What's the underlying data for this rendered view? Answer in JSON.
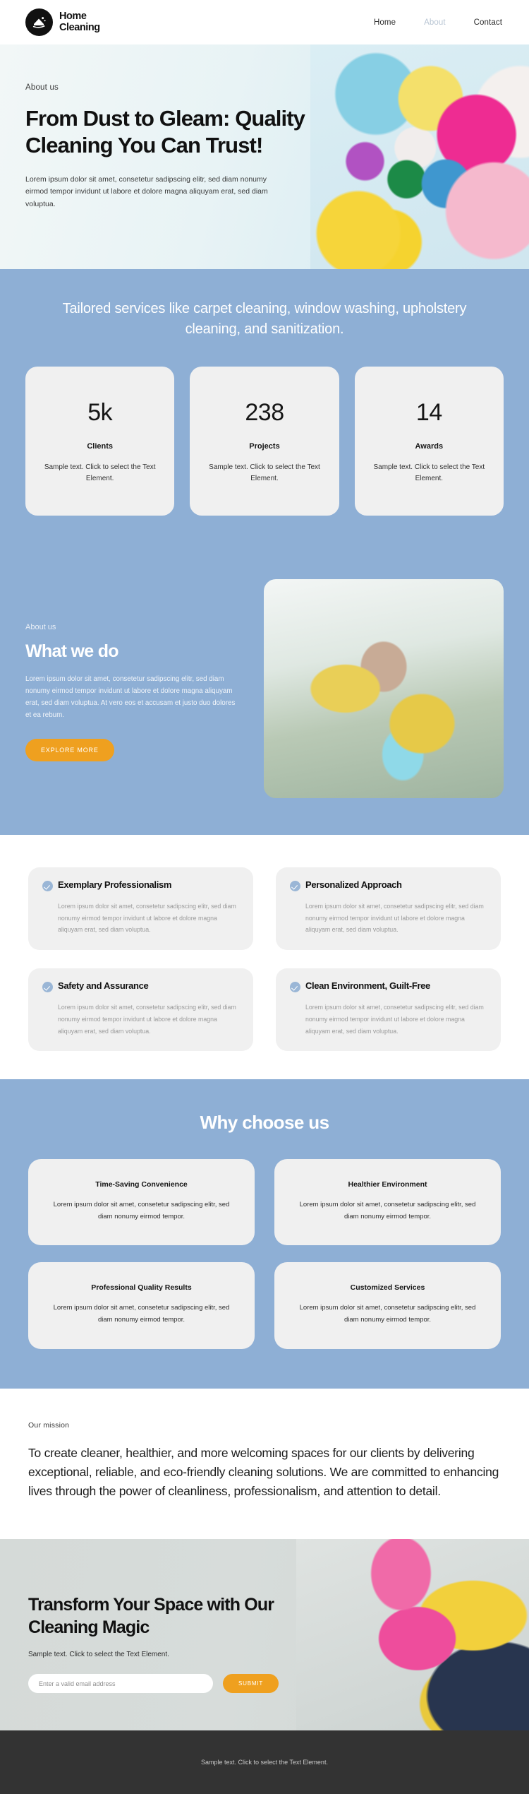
{
  "header": {
    "brand_line1": "Home",
    "brand_line2": "Cleaning",
    "logo_icon": "house-sparkle-icon",
    "nav": [
      {
        "label": "Home",
        "active": false
      },
      {
        "label": "About",
        "active": true
      },
      {
        "label": "Contact",
        "active": false
      }
    ]
  },
  "hero": {
    "eyebrow": "About us",
    "title": "From Dust to Gleam: Quality Cleaning You Can Trust!",
    "paragraph": "Lorem ipsum dolor sit amet, consetetur sadipscing elitr, sed diam nonumy eirmod tempor invidunt ut labore et dolore magna aliquyam erat, sed diam voluptua.",
    "image_alt": "bucket-of-cleaning-supplies-photo"
  },
  "stats": {
    "lead": "Tailored services like carpet cleaning, window washing, upholstery cleaning, and sanitization.",
    "cards": [
      {
        "number": "5k",
        "label": "Clients",
        "desc": "Sample text. Click to select the Text Element."
      },
      {
        "number": "238",
        "label": "Projects",
        "desc": "Sample text. Click to select the Text Element."
      },
      {
        "number": "14",
        "label": "Awards",
        "desc": "Sample text. Click to select the Text Element."
      }
    ]
  },
  "what_we_do": {
    "eyebrow": "About us",
    "title": "What we do",
    "paragraph": "Lorem ipsum dolor sit amet, consetetur sadipscing elitr, sed diam nonumy eirmod tempor invidunt ut labore et dolore magna aliquyam erat, sed diam voluptua. At vero eos et accusam et justo duo dolores et ea rebum.",
    "button_label": "EXPLORE MORE",
    "image_alt": "woman-cleaning-window-with-squeegee-photo"
  },
  "features": {
    "check_icon": "check-circle-icon",
    "items": [
      {
        "title": "Exemplary Professionalism",
        "body": "Lorem ipsum dolor sit amet, consetetur sadipscing elitr, sed diam nonumy eirmod tempor invidunt ut labore et dolore magna aliquyam erat, sed diam voluptua."
      },
      {
        "title": "Personalized Approach",
        "body": "Lorem ipsum dolor sit amet, consetetur sadipscing elitr, sed diam nonumy eirmod tempor invidunt ut labore et dolore magna aliquyam erat, sed diam voluptua."
      },
      {
        "title": "Safety and Assurance",
        "body": "Lorem ipsum dolor sit amet, consetetur sadipscing elitr, sed diam nonumy eirmod tempor invidunt ut labore et dolore magna aliquyam erat, sed diam voluptua."
      },
      {
        "title": "Clean Environment, Guilt-Free",
        "body": "Lorem ipsum dolor sit amet, consetetur sadipscing elitr, sed diam nonumy eirmod tempor invidunt ut labore et dolore magna aliquyam erat, sed diam voluptua."
      }
    ]
  },
  "why": {
    "title": "Why choose us",
    "cards": [
      {
        "title": "Time-Saving Convenience",
        "body": "Lorem ipsum dolor sit amet, consetetur sadipscing elitr, sed diam nonumy eirmod tempor."
      },
      {
        "title": "Healthier Environment",
        "body": "Lorem ipsum dolor sit amet, consetetur sadipscing elitr, sed diam nonumy eirmod tempor."
      },
      {
        "title": "Professional Quality Results",
        "body": "Lorem ipsum dolor sit amet, consetetur sadipscing elitr, sed diam nonumy eirmod tempor."
      },
      {
        "title": "Customized Services",
        "body": "Lorem ipsum dolor sit amet, consetetur sadipscing elitr, sed diam nonumy eirmod tempor."
      }
    ]
  },
  "mission": {
    "eyebrow": "Our mission",
    "text": "To create cleaner, healthier, and more welcoming spaces for our clients by delivering exceptional, reliable, and eco-friendly cleaning solutions. We are committed to enhancing lives through the power of cleanliness, professionalism, and attention to detail."
  },
  "cta": {
    "title": "Transform Your Space with Our Cleaning Magic",
    "subtitle": "Sample text. Click to select the Text Element.",
    "email_placeholder": "Enter a valid email address",
    "email_value": "",
    "submit_label": "SUBMIT",
    "image_alt": "gloved-hand-holding-pink-spray-bottle-photo"
  },
  "footer": {
    "text": "Sample text. Click to select the Text Element."
  },
  "colors": {
    "accent_orange": "#efa01f",
    "brand_blue": "#8eafd5",
    "card_gray": "#f0f0f0",
    "footer_dark": "#333333",
    "nav_active": "#b9c6d4",
    "check_blue": "#9ab6d6"
  }
}
